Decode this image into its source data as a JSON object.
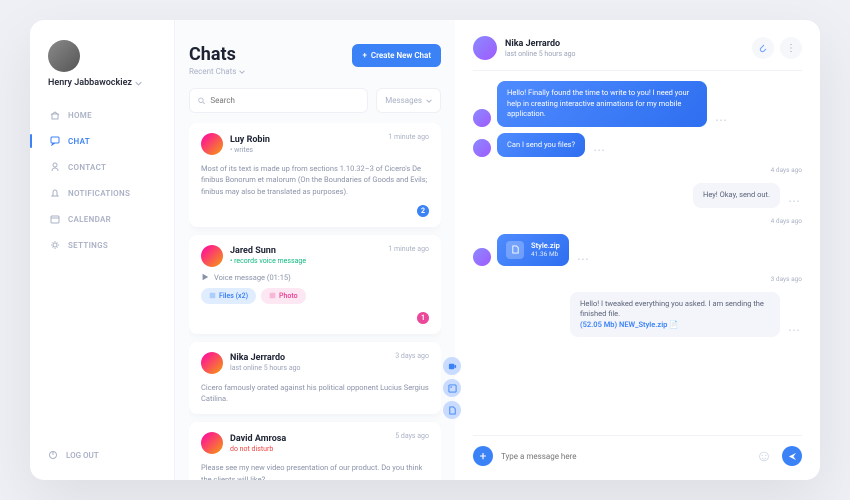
{
  "profile": {
    "name": "Henry Jabbawockiez"
  },
  "nav": {
    "items": [
      {
        "label": "HOME",
        "icon": "home"
      },
      {
        "label": "CHAT",
        "icon": "chat",
        "active": true
      },
      {
        "label": "CONTACT",
        "icon": "contact"
      },
      {
        "label": "NOTIFICATIONS",
        "icon": "bell"
      },
      {
        "label": "CALENDAR",
        "icon": "calendar"
      },
      {
        "label": "SETTINGS",
        "icon": "gear"
      }
    ],
    "logout": "LOG OUT"
  },
  "chatList": {
    "title": "Chats",
    "subtitle": "Recent Chats",
    "newChat": "Create New Chat",
    "searchPlaceholder": "Search",
    "filterLabel": "Messages",
    "cards": [
      {
        "name": "Luy Robin",
        "status": "• writes",
        "time": "1 minute ago",
        "body": "Most of its text is made up from sections 1.10.32–3 of Cicero's De finibus Bonorum et malorum (On the Boundaries of Goods and Evils; finibus may also be translated as purposes).",
        "badge": "2",
        "badgeColor": "blue"
      },
      {
        "name": "Jared Sunn",
        "status": "• records voice message",
        "statusColor": "green",
        "time": "1 minute ago",
        "voice": "Voice message (01:15)",
        "chips": [
          {
            "label": "Files (x2)",
            "c": "blue"
          },
          {
            "label": "Photo",
            "c": "pink"
          }
        ],
        "badge": "1",
        "badgeColor": "pink"
      },
      {
        "name": "Nika Jerrardo",
        "status": "last online 5 hours ago",
        "time": "3 days ago",
        "body": "Cicero famously orated against his political opponent Lucius Sergius Catilina."
      },
      {
        "name": "David Amrosa",
        "status": "do not disturb",
        "statusColor": "red",
        "time": "5 days ago",
        "body": "Please see my new video presentation of our product. Do you think the clients will like?"
      }
    ]
  },
  "convo": {
    "name": "Nika Jerrardo",
    "status": "last online 5 hours ago",
    "messages": [
      {
        "dir": "in",
        "text": "Hello! Finally found the time to write to you! I need your help in creating interactive animations for my mobile application."
      },
      {
        "dir": "in",
        "text": "Can I send you files?"
      },
      {
        "div": "4 days ago"
      },
      {
        "dir": "out",
        "text": "Hey! Okay, send out."
      },
      {
        "div": "4 days ago"
      },
      {
        "dir": "in",
        "file": {
          "name": "Style.zip",
          "size": "41.36 Mb"
        }
      },
      {
        "div": "3 days ago"
      },
      {
        "dir": "out",
        "text": "Hello! I tweaked everything you asked. I am sending the finished file.",
        "link": "(52.05 Mb) NEW_Style.zip"
      }
    ],
    "composerPlaceholder": "Type a message here"
  }
}
